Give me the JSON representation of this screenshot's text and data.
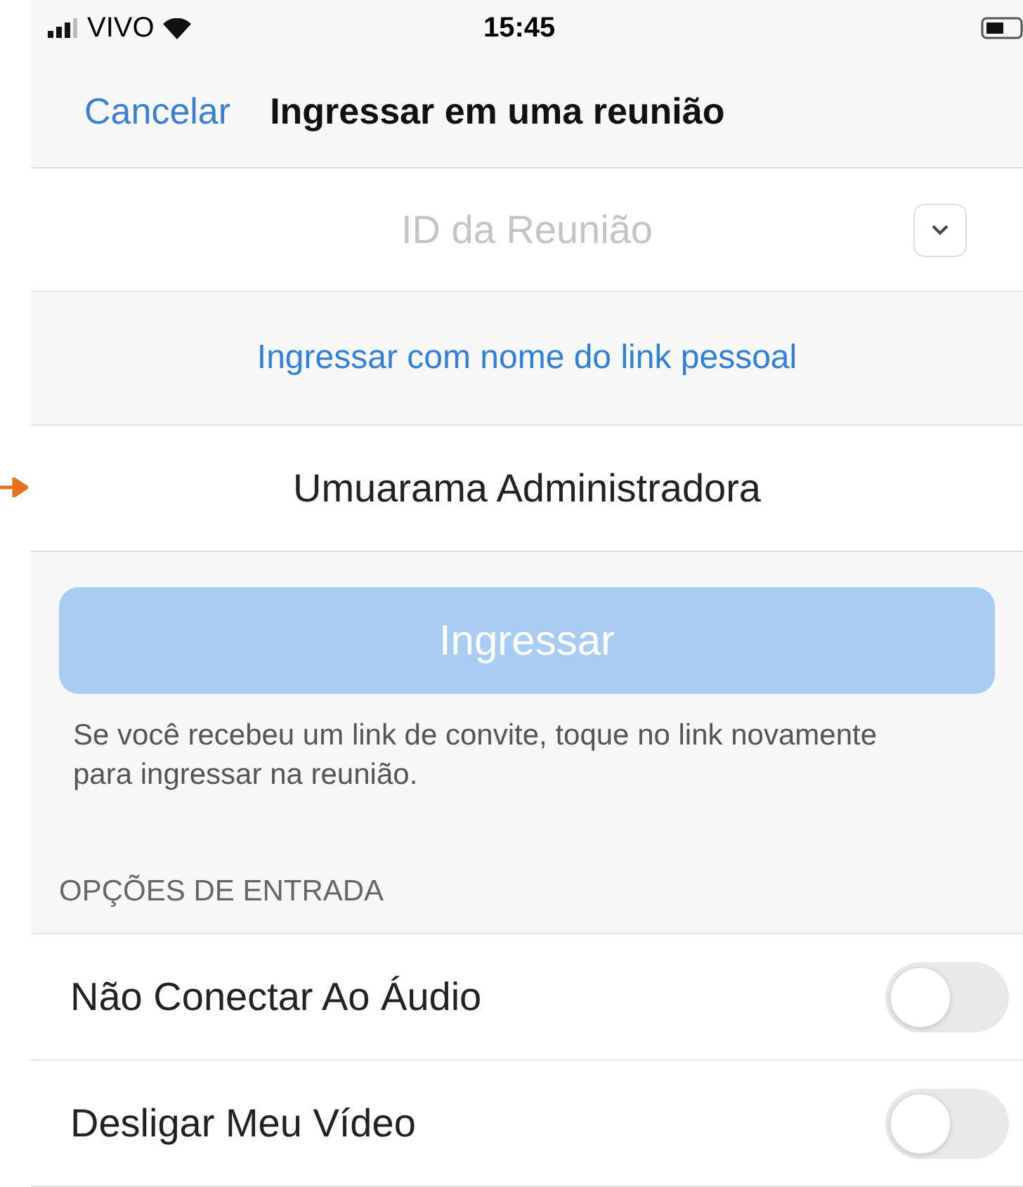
{
  "status_bar": {
    "carrier": "VIVO",
    "time": "15:45"
  },
  "nav": {
    "cancel": "Cancelar",
    "title": "Ingressar em uma reunião"
  },
  "meeting_id": {
    "placeholder": "ID da Reunião"
  },
  "personal_link": "Ingressar com nome do link pessoal",
  "name_field": {
    "value": "Umuarama Administradora"
  },
  "join_button": {
    "label": "Ingressar",
    "disabled": true
  },
  "help_text": "Se você recebeu um link de convite, toque no link novamente para ingressar na reunião.",
  "options": {
    "header": "OPÇÕES DE ENTRADA",
    "items": [
      {
        "label": "Não Conectar Ao Áudio",
        "on": false
      },
      {
        "label": "Desligar Meu Vídeo",
        "on": false
      }
    ]
  }
}
